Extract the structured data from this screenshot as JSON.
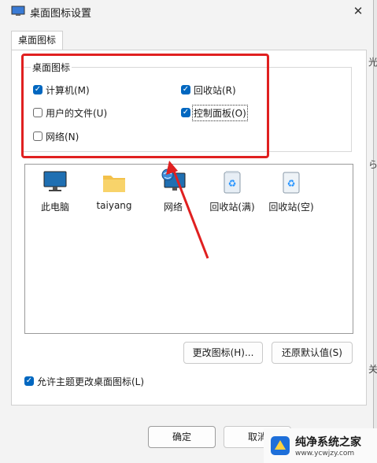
{
  "window": {
    "title": "桌面图标设置",
    "close_glyph": "✕"
  },
  "tab": {
    "label": "桌面图标"
  },
  "group": {
    "label": "桌面图标",
    "options": [
      {
        "label": "计算机(M)",
        "checked": true
      },
      {
        "label": "回收站(R)",
        "checked": true
      },
      {
        "label": "用户的文件(U)",
        "checked": false
      },
      {
        "label": "控制面板(O)",
        "checked": true
      },
      {
        "label": "网络(N)",
        "checked": false
      }
    ]
  },
  "icons": [
    {
      "label": "此电脑",
      "icon": "monitor-icon"
    },
    {
      "label": "taiyang",
      "icon": "folder-icon"
    },
    {
      "label": "网络",
      "icon": "network-icon"
    },
    {
      "label": "回收站(满)",
      "icon": "recycle-bin-full-icon"
    },
    {
      "label": "回收站(空)",
      "icon": "recycle-bin-empty-icon"
    }
  ],
  "buttons": {
    "change_icon": "更改图标(H)...",
    "restore_default": "还原默认值(S)",
    "ok": "确定",
    "cancel": "取消"
  },
  "allow_themes": {
    "label": "允许主题更改桌面图标(L)",
    "checked": true
  },
  "side_text": [
    "光",
    "ら",
    "关"
  ],
  "watermark": {
    "title": "纯净系统之家",
    "url": "www.ycwjzy.com"
  },
  "colors": {
    "accent": "#0067c0",
    "annotation": "#e02020"
  }
}
